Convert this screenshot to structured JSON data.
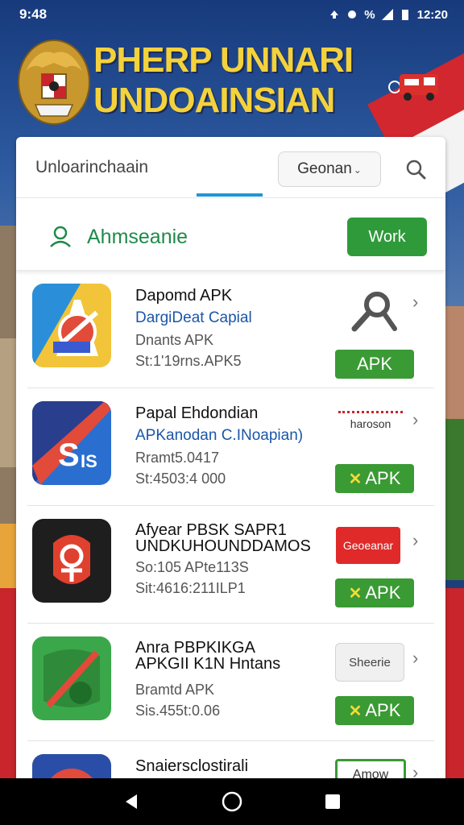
{
  "statusbar": {
    "time_left": "9:48",
    "signal_text": "%",
    "time_right": "12:20"
  },
  "banner": {
    "title_line1": "PHERP UNNARI",
    "title_line2": "UNDOAINSIAN",
    "accent": "#f4d23c"
  },
  "toolbar": {
    "search_text": "Unloarinchaain",
    "dropdown_value": "Geonan",
    "search_icon": "search-icon"
  },
  "section": {
    "label": "Ahmseanie",
    "button": "Work",
    "icon": "person-pin-icon"
  },
  "apps": [
    {
      "name": "Dapomd APK",
      "subtitle": "DargiDeat Capial",
      "meta1": "Dnants APK",
      "meta2": "St:1'19rns.APK5",
      "action_type": "icon",
      "action_icon": "search-icon",
      "download_label": "APK",
      "download_has_x": false
    },
    {
      "name": "Papal Ehdondian",
      "subtitle": "APKanodan C.INoapian)",
      "meta1": "Rramt5.0417",
      "meta2": "St:4503:4 000",
      "action_type": "text",
      "action_label": "haroson",
      "download_label": "APK",
      "download_has_x": true
    },
    {
      "name": "Afyear PBSK SAPR1",
      "name2": "UNDKUHOUNDDAMOS",
      "meta1": "So:105 APte113S",
      "meta2": "Sit:4616:211ILP1",
      "action_type": "red",
      "action_label": "Geoeanar",
      "download_label": "APK",
      "download_has_x": true
    },
    {
      "name": "Anra PBPKIKGA",
      "name2": "APKGII K1N Hntans",
      "meta1": "Bramtd APK",
      "meta2": "Sis.455t:0.06",
      "action_type": "gray",
      "action_label": "Sheerie",
      "download_label": "APK",
      "download_has_x": true
    },
    {
      "name": "Snaiersclostirali",
      "action_type": "outline",
      "action_label": "Amow"
    }
  ],
  "colors": {
    "green": "#3a9a34",
    "red": "#e02a2a",
    "blue_link": "#1a56a8",
    "tab_indicator": "#2196d3"
  },
  "navbar": {
    "back_icon": "back-triangle-icon",
    "home_icon": "home-circle-icon",
    "recents_icon": "recents-square-icon"
  }
}
